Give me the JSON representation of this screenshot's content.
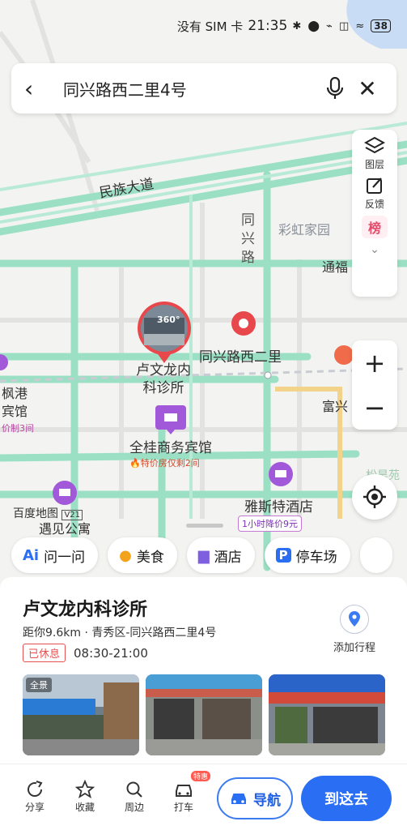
{
  "status_bar": {
    "carrier": "没有 SIM 卡",
    "time": "21:35",
    "icons": "✱ ⬤ ⌁ ◫ ≈",
    "battery": "38"
  },
  "search": {
    "query": "同兴路西二里4号"
  },
  "map": {
    "labels": {
      "minzu": "民族大道",
      "tongxing_road": "同兴路",
      "caihong": "彩虹家园",
      "tongfu": "通福",
      "fuxing": "富兴",
      "fenggang": "枫港",
      "bingguan": "宾馆",
      "jia3": "价制3间",
      "baidu": "百度地图",
      "baidu_badge": "V21",
      "yujian": "遇见公寓",
      "songhao": "松昊苑"
    },
    "pois": {
      "clinic": "卢文龙内科诊所",
      "clinic_badge": "360°",
      "destination": "同兴路西二里",
      "quangui": "全桂商务宾馆",
      "quangui_promo": "🔥特价房仅剩2间",
      "yasite": "雅斯特酒店",
      "yasite_promo": "1小时降价9元"
    }
  },
  "tools": {
    "layers": "图层",
    "feedback": "反馈",
    "rank": "榜",
    "zoom_in": "+",
    "zoom_out": "−"
  },
  "chips": [
    {
      "icon": "Ai",
      "label": "问一问"
    },
    {
      "icon": "●",
      "label": "美食"
    },
    {
      "icon": "▆",
      "label": "酒店"
    },
    {
      "icon": "P",
      "label": "停车场"
    }
  ],
  "place": {
    "name": "卢文龙内科诊所",
    "meta": "距你9.6km · 青秀区-同兴路西二里4号",
    "status": "已休息",
    "hours": "08:30-21:00",
    "add_route": "添加行程",
    "pano_tag": "全景"
  },
  "actions": {
    "share": "分享",
    "favorite": "收藏",
    "nearby": "周边",
    "taxi": "打车",
    "taxi_badge": "特惠",
    "navigate": "导航",
    "go": "到这去"
  },
  "colors": {
    "road_green": "#9be0c4",
    "accent_blue": "#2a6ef3",
    "marker_red": "#e8474b",
    "hotel_purple": "#a259d9"
  }
}
